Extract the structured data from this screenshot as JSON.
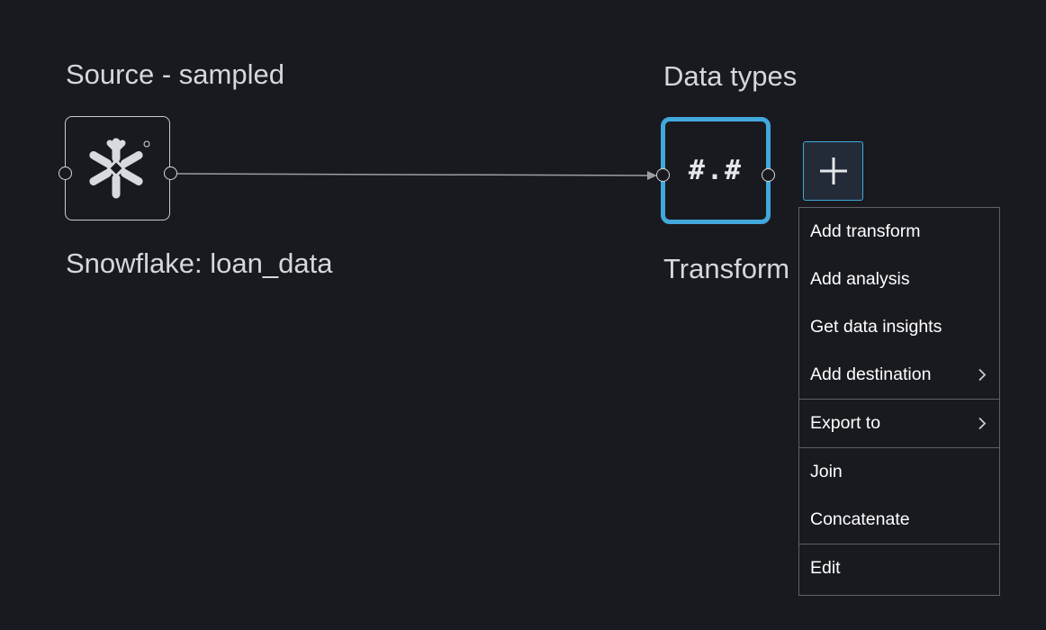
{
  "source_node": {
    "title": "Source - sampled",
    "label": "Snowflake: loan_data",
    "icon": "snowflake-icon"
  },
  "transform_node": {
    "title": "Data types",
    "label": "Transform",
    "symbol": "#.#"
  },
  "add_button": {
    "icon": "plus-icon"
  },
  "context_menu": {
    "groups": [
      {
        "items": [
          {
            "label": "Add transform",
            "submenu": false
          },
          {
            "label": "Add analysis",
            "submenu": false
          },
          {
            "label": "Get data insights",
            "submenu": false
          },
          {
            "label": "Add destination",
            "submenu": true
          }
        ]
      },
      {
        "items": [
          {
            "label": "Export to",
            "submenu": true
          }
        ]
      },
      {
        "items": [
          {
            "label": "Join",
            "submenu": false
          },
          {
            "label": "Concatenate",
            "submenu": false
          }
        ]
      },
      {
        "items": [
          {
            "label": "Edit",
            "submenu": false
          }
        ]
      }
    ]
  },
  "colors": {
    "background": "#191a1f",
    "selected_border": "#42a8dc",
    "text": "#d5d7dc",
    "menu_border": "#5f6166"
  }
}
